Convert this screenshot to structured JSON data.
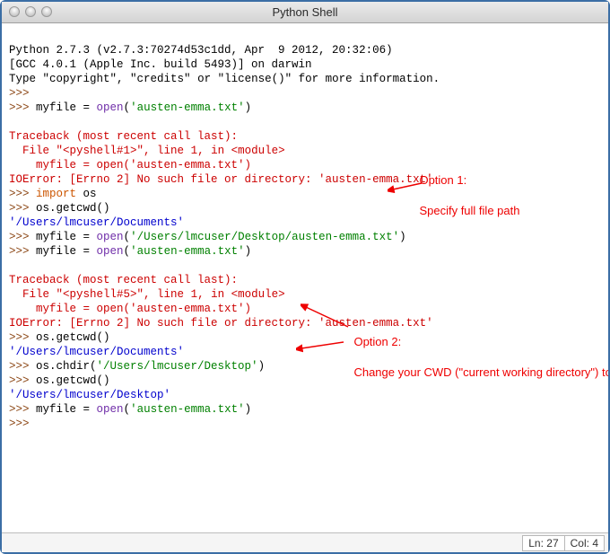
{
  "window": {
    "title": "Python Shell"
  },
  "terminal": {
    "banner_l1": "Python 2.7.3 (v2.7.3:70274d53c1dd, Apr  9 2012, 20:32:06) ",
    "banner_l2": "[GCC 4.0.1 (Apple Inc. build 5493)] on darwin",
    "banner_l3_a": "Type ",
    "banner_l3_b": "\"copyright\"",
    "banner_l3_c": ", ",
    "banner_l3_d": "\"credits\"",
    "banner_l3_e": " or ",
    "banner_l3_f": "\"license()\"",
    "banner_l3_g": " for more information.",
    "prompt": ">>> ",
    "cmd1_a": "myfile = ",
    "cmd1_b": "open",
    "cmd1_c": "(",
    "cmd1_d": "'austen-emma.txt'",
    "cmd1_e": ")",
    "tb_line1": "Traceback (most recent call last):",
    "tb_line2a": "  File ",
    "tb_line2b": "\"<pyshell#1>\"",
    "tb_line2c": ", line ",
    "tb_line2d": "1",
    "tb_line2e": ", in ",
    "tb_line2f": "<module>",
    "tb_line3": "    myfile = open('austen-emma.txt')",
    "tb_line4": "IOError: [Errno 2] No such file or directory: 'austen-emma.txt'",
    "cmd_import_a": "import",
    "cmd_import_b": " os",
    "cmd_getcwd": "os.getcwd()",
    "out_docs": "'/Users/lmcuser/Documents'",
    "cmd_open_full_a": "myfile = ",
    "cmd_open_full_b": "open",
    "cmd_open_full_c": "(",
    "cmd_open_full_d": "'/Users/lmcuser/Desktop/austen-emma.txt'",
    "cmd_open_full_e": ")",
    "tb2_line2b": "\"<pyshell#5>\"",
    "cmd_chdir_a": "os.chdir(",
    "cmd_chdir_b": "'/Users/lmcuser/Desktop'",
    "cmd_chdir_c": ")",
    "out_desktop": "'/Users/lmcuser/Desktop'"
  },
  "annotations": {
    "opt1_l1": "Option 1:",
    "opt1_l2": "Specify full file path",
    "opt2_l1": "Option 2:",
    "opt2_l2": "Change your CWD (\"current working directory\") to where the file is located. Then you can refer to the file by its name only."
  },
  "statusbar": {
    "ln_label": "Ln: ",
    "ln_value": "27",
    "col_label": "Col: ",
    "col_value": "4"
  }
}
